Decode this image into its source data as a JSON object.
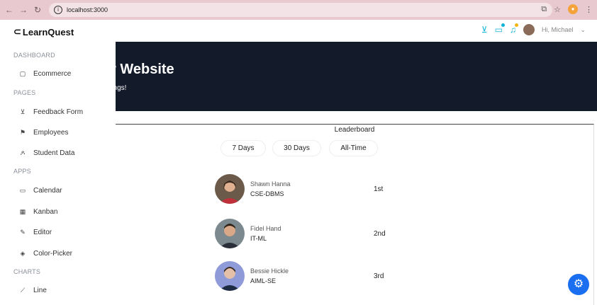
{
  "browser": {
    "url": "localhost:3000"
  },
  "sidebar": {
    "logo": "LearnQuest",
    "sections": [
      {
        "label": "DASHBOARD",
        "items": [
          {
            "label": "Ecommerce",
            "icon": "bag-icon"
          }
        ]
      },
      {
        "label": "PAGES",
        "items": [
          {
            "label": "Feedback Form",
            "icon": "cart-icon"
          },
          {
            "label": "Employees",
            "icon": "people-icon"
          },
          {
            "label": "Student Data",
            "icon": "user-group-icon"
          }
        ]
      },
      {
        "label": "APPS",
        "items": [
          {
            "label": "Calendar",
            "icon": "calendar-icon"
          },
          {
            "label": "Kanban",
            "icon": "kanban-icon"
          },
          {
            "label": "Editor",
            "icon": "edit-icon"
          },
          {
            "label": "Color-Picker",
            "icon": "color-picker-icon"
          }
        ]
      },
      {
        "label": "CHARTS",
        "items": [
          {
            "label": "Line",
            "icon": "line-chart-icon"
          }
        ]
      }
    ]
  },
  "header": {
    "greeting": "Hi, Michael",
    "accent": "#0fb3d6"
  },
  "hero": {
    "title": "r Website",
    "subtitle": "things!"
  },
  "leaderboard": {
    "title": "Leaderboard",
    "filters": [
      "7 Days",
      "30 Days",
      "All-Time"
    ],
    "rows": [
      {
        "name": "Shawn Hanna",
        "dept": "CSE-DBMS",
        "rank": "1st"
      },
      {
        "name": "Fidel Hand",
        "dept": "IT-ML",
        "rank": "2nd"
      },
      {
        "name": "Bessie Hickle",
        "dept": "AIML-SE",
        "rank": "3rd"
      }
    ]
  },
  "colors": {
    "hero_bg": "#131b2b",
    "fab": "#1a6ff0"
  }
}
